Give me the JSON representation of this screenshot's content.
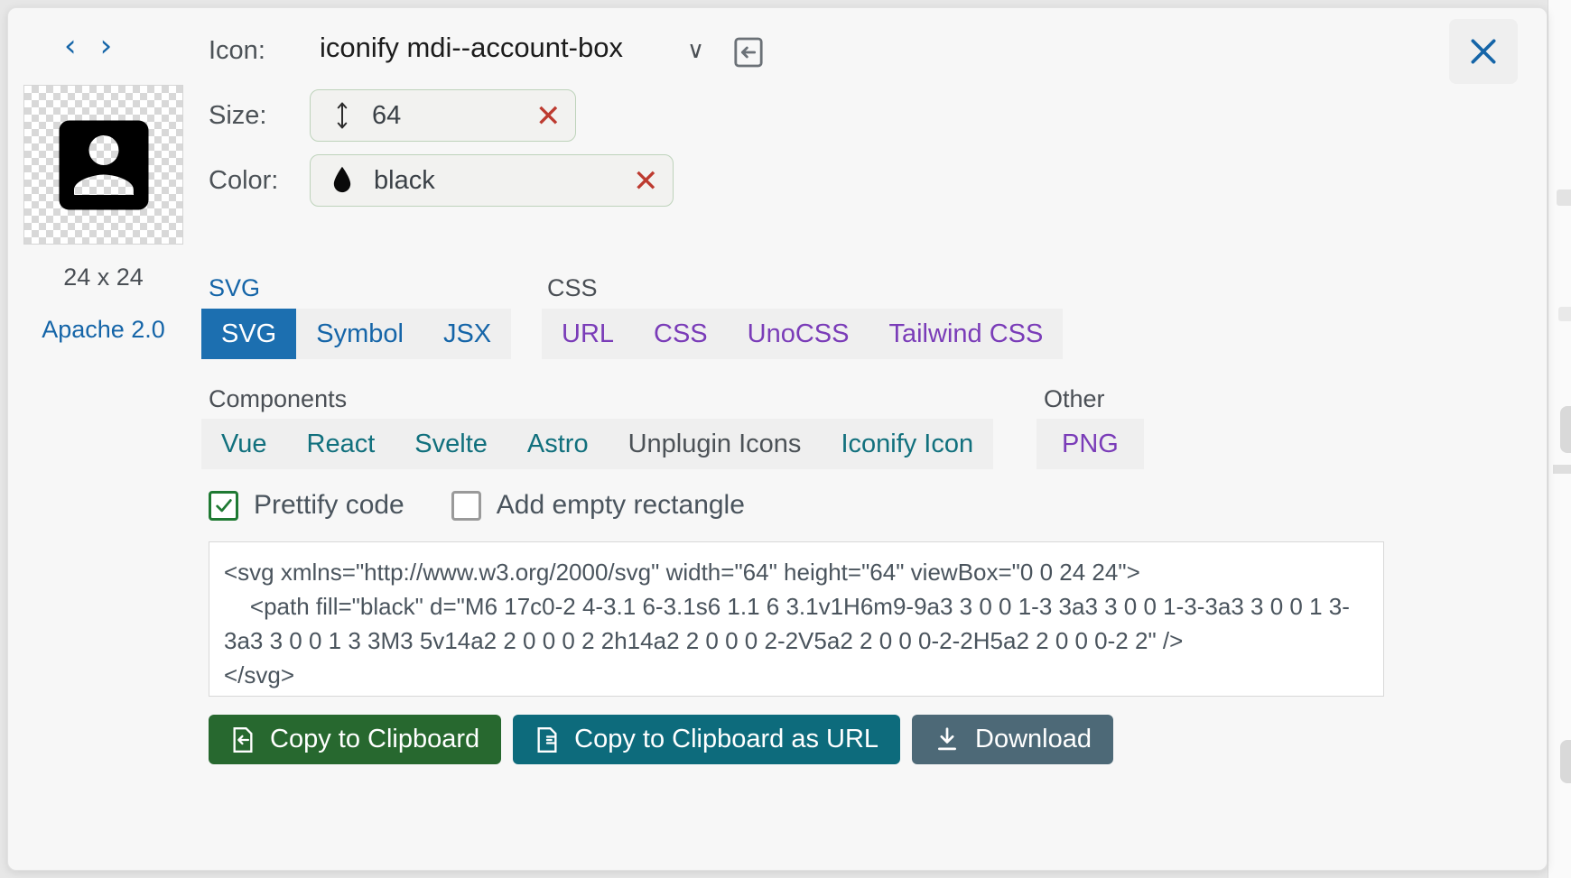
{
  "header": {
    "prev_label": "‹",
    "next_label": "›",
    "icon_label": "Icon:",
    "icon_name": "iconify mdi--account-box",
    "chevron": "∨",
    "close_label": "×"
  },
  "preview": {
    "size_text": "24 x 24",
    "license": "Apache 2.0"
  },
  "fields": {
    "size_label": "Size:",
    "size_value": "64",
    "color_label": "Color:",
    "color_value": "black",
    "clear_glyph": "✕"
  },
  "groups": {
    "svg_label": "SVG",
    "css_label": "CSS",
    "components_label": "Components",
    "other_label": "Other"
  },
  "tabs": {
    "svg": [
      {
        "label": "SVG",
        "active": true
      },
      {
        "label": "Symbol",
        "active": false
      },
      {
        "label": "JSX",
        "active": false
      }
    ],
    "css": [
      {
        "label": "URL",
        "active": false
      },
      {
        "label": "CSS",
        "active": false
      },
      {
        "label": "UnoCSS",
        "active": false
      },
      {
        "label": "Tailwind CSS",
        "active": false
      }
    ],
    "components": [
      {
        "label": "Vue",
        "active": false
      },
      {
        "label": "React",
        "active": false
      },
      {
        "label": "Svelte",
        "active": false
      },
      {
        "label": "Astro",
        "active": false
      },
      {
        "label": "Unplugin Icons",
        "active": false
      },
      {
        "label": "Iconify Icon",
        "active": false
      }
    ],
    "other": [
      {
        "label": "PNG",
        "active": false
      }
    ]
  },
  "options": {
    "prettify_label": "Prettify code",
    "prettify_checked": true,
    "empty_rect_label": "Add empty rectangle",
    "empty_rect_checked": false,
    "check_glyph": "✓"
  },
  "code": {
    "text": "<svg xmlns=\"http://www.w3.org/2000/svg\" width=\"64\" height=\"64\" viewBox=\"0 0 24 24\">\n    <path fill=\"black\" d=\"M6 17c0-2 4-3.1 6-3.1s6 1.1 6 3.1v1H6m9-9a3 3 0 0 1-3 3a3 3 0 0 1-3-3a3 3 0 0 1 3-3a3 3 0 0 1 3 3M3 5v14a2 2 0 0 0 2 2h14a2 2 0 0 0 2-2V5a2 2 0 0 0-2-2H5a2 2 0 0 0-2 2\" />\n</svg>"
  },
  "buttons": {
    "copy_clipboard": "Copy to Clipboard",
    "copy_url": "Copy to Clipboard as URL",
    "download": "Download"
  },
  "colors": {
    "accent_blue": "#1565a8",
    "tab_active_bg": "#1c6fb0",
    "purple": "#7a3cb8",
    "teal": "#11707d",
    "green_btn": "#27682f",
    "teal_btn": "#0d6b7c",
    "slate_btn": "#4d6977",
    "clear_red": "#bd3b30"
  }
}
